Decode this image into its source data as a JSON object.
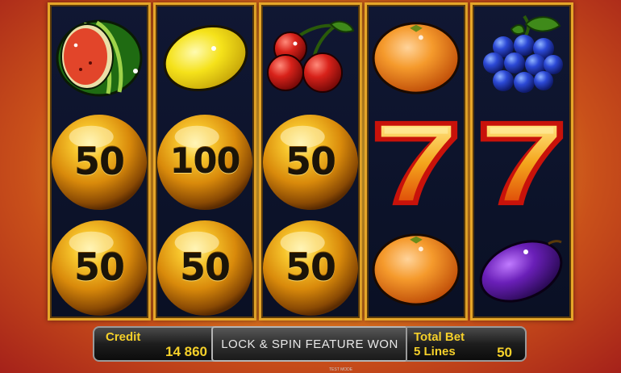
{
  "reels": [
    {
      "symbols": [
        "watermelon-icon",
        "coin-50",
        "coin-50"
      ],
      "coin_values": [
        "",
        "50",
        "50"
      ]
    },
    {
      "symbols": [
        "lemon-icon",
        "coin-100",
        "coin-50"
      ],
      "coin_values": [
        "",
        "100",
        "50"
      ]
    },
    {
      "symbols": [
        "cherries-icon",
        "coin-50",
        "coin-50"
      ],
      "coin_values": [
        "",
        "50",
        "50"
      ]
    },
    {
      "symbols": [
        "orange-icon",
        "seven-icon",
        "orange-icon"
      ]
    },
    {
      "symbols": [
        "grapes-icon",
        "seven-icon",
        "plum-icon"
      ]
    }
  ],
  "status": {
    "credit_label": "Credit",
    "credit_value": "14 860",
    "message": "LOCK & SPIN FEATURE WON",
    "total_bet_label": "Total Bet",
    "lines_label": "5 Lines",
    "bet_value": "50",
    "footer_text": "TEST MODE"
  },
  "colors": {
    "label_yellow": "#f5d02a",
    "reel_border": "#e6a629",
    "reel_bg": "#0a1024"
  }
}
